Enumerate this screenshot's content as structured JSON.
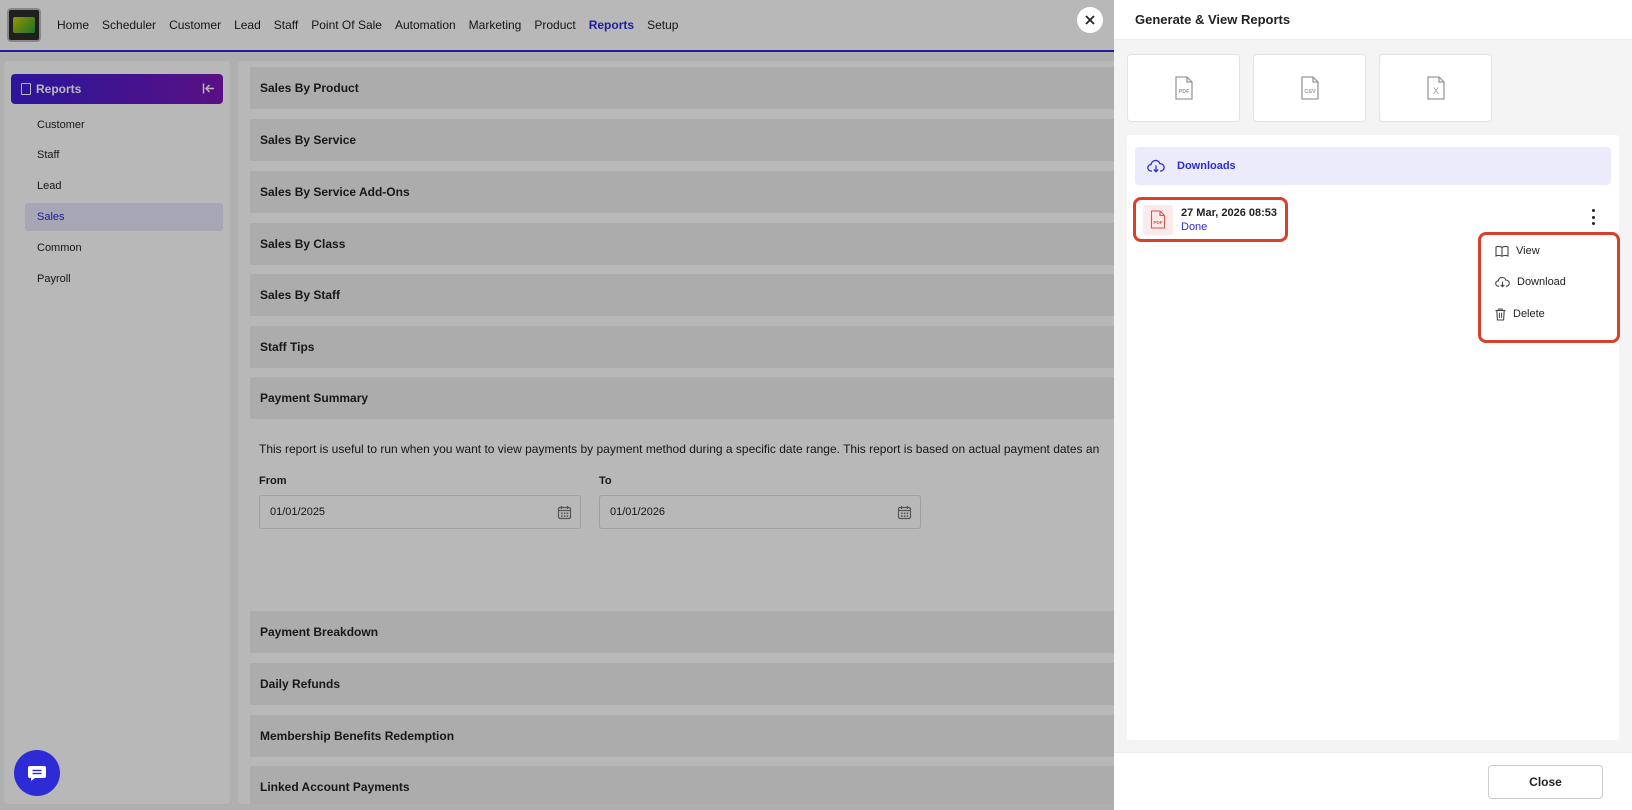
{
  "nav": {
    "items": [
      "Home",
      "Scheduler",
      "Customer",
      "Lead",
      "Staff",
      "Point Of Sale",
      "Automation",
      "Marketing",
      "Product",
      "Reports",
      "Setup"
    ],
    "active": "Reports"
  },
  "sidebar": {
    "title": "Reports",
    "items": [
      "Customer",
      "Staff",
      "Lead",
      "Sales",
      "Common",
      "Payroll"
    ],
    "active": "Sales"
  },
  "main": {
    "sections_top": [
      "Sales By Product",
      "Sales By Service",
      "Sales By Service Add-Ons",
      "Sales By Class",
      "Sales By Staff",
      "Staff Tips",
      "Payment Summary"
    ],
    "description": "This report is useful to run when you want to view payments by payment method during a specific date range. This report is based on actual payment dates an",
    "from_label": "From",
    "from_value": "01/01/2025",
    "to_label": "To",
    "to_value": "01/01/2026",
    "sections_bottom": [
      "Payment Breakdown",
      "Daily Refunds",
      "Membership Benefits Redemption",
      "Linked Account Payments"
    ]
  },
  "panel": {
    "title": "Generate & View Reports",
    "formats": [
      "PDF",
      "CSV",
      "X"
    ],
    "downloads_label": "Downloads",
    "file": {
      "date": "27 Mar, 2026 08:53",
      "status": "Done",
      "type": "PDF"
    },
    "menu": {
      "view": "View",
      "download": "Download",
      "delete": "Delete"
    },
    "close_label": "Close"
  },
  "colors": {
    "accent": "#2d2bd6",
    "highlight": "#d9402b",
    "overlay": "rgba(0,0,0,0.28)"
  }
}
